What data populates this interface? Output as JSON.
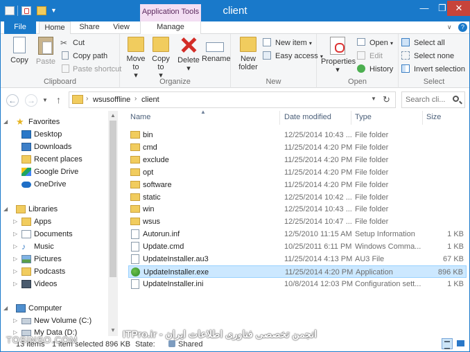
{
  "window": {
    "title": "client",
    "context_tab_label": "Application Tools",
    "min": "—",
    "max": "❐",
    "close": "✕"
  },
  "ribbon_tabs": [
    "File",
    "Home",
    "Share",
    "View",
    "Manage"
  ],
  "ribbon": {
    "clipboard": {
      "label": "Clipboard",
      "copy": "Copy",
      "paste": "Paste",
      "cut": "Cut",
      "copy_path": "Copy path",
      "paste_shortcut": "Paste shortcut"
    },
    "organize": {
      "label": "Organize",
      "move_to": "Move to",
      "copy_to": "Copy to",
      "delete": "Delete",
      "rename": "Rename"
    },
    "new": {
      "label": "New",
      "new_folder": "New folder",
      "new_item": "New item",
      "easy_access": "Easy access"
    },
    "open": {
      "label": "Open",
      "properties": "Properties",
      "open": "Open",
      "edit": "Edit",
      "history": "History"
    },
    "select": {
      "label": "Select",
      "select_all": "Select all",
      "select_none": "Select none",
      "invert_selection": "Invert selection"
    }
  },
  "address": {
    "crumbs": [
      "wsusoffline",
      "client"
    ],
    "search_placeholder": "Search cli..."
  },
  "nav_pane": {
    "items": [
      {
        "label": "Favorites",
        "icon": "star-icon"
      },
      {
        "label": "Desktop",
        "icon": "desktop-icon"
      },
      {
        "label": "Downloads",
        "icon": "downloads-icon"
      },
      {
        "label": "Recent places",
        "icon": "recent-places-icon"
      },
      {
        "label": "Google Drive",
        "icon": "google-drive-icon"
      },
      {
        "label": "OneDrive",
        "icon": "onedrive-icon"
      },
      {
        "label": "Libraries",
        "icon": "libraries-icon"
      },
      {
        "label": "Apps",
        "icon": "folder-icon"
      },
      {
        "label": "Documents",
        "icon": "documents-icon"
      },
      {
        "label": "Music",
        "icon": "music-icon"
      },
      {
        "label": "Pictures",
        "icon": "pictures-icon"
      },
      {
        "label": "Podcasts",
        "icon": "podcasts-icon"
      },
      {
        "label": "Videos",
        "icon": "videos-icon"
      },
      {
        "label": "Computer",
        "icon": "computer-icon"
      },
      {
        "label": "New Volume (C:)",
        "icon": "drive-icon"
      },
      {
        "label": "My Data (D:)",
        "icon": "drive-icon"
      }
    ]
  },
  "file_list": {
    "columns": [
      "Name",
      "Date modified",
      "Type",
      "Size"
    ],
    "rows": [
      {
        "name": "bin",
        "date": "12/25/2014 10:43 ...",
        "type": "File folder",
        "size": "",
        "kind": "folder"
      },
      {
        "name": "cmd",
        "date": "11/25/2014 4:20 PM",
        "type": "File folder",
        "size": "",
        "kind": "folder"
      },
      {
        "name": "exclude",
        "date": "11/25/2014 4:20 PM",
        "type": "File folder",
        "size": "",
        "kind": "folder"
      },
      {
        "name": "opt",
        "date": "11/25/2014 4:20 PM",
        "type": "File folder",
        "size": "",
        "kind": "folder"
      },
      {
        "name": "software",
        "date": "11/25/2014 4:20 PM",
        "type": "File folder",
        "size": "",
        "kind": "folder"
      },
      {
        "name": "static",
        "date": "12/25/2014 10:42 ...",
        "type": "File folder",
        "size": "",
        "kind": "folder"
      },
      {
        "name": "win",
        "date": "12/25/2014 10:43 ...",
        "type": "File folder",
        "size": "",
        "kind": "folder"
      },
      {
        "name": "wsus",
        "date": "12/25/2014 10:47 ...",
        "type": "File folder",
        "size": "",
        "kind": "folder"
      },
      {
        "name": "Autorun.inf",
        "date": "12/5/2010 11:15 AM",
        "type": "Setup Information",
        "size": "1 KB",
        "kind": "file"
      },
      {
        "name": "Update.cmd",
        "date": "10/25/2011 6:11 PM",
        "type": "Windows Comma...",
        "size": "1 KB",
        "kind": "file"
      },
      {
        "name": "UpdateInstaller.au3",
        "date": "11/25/2014 4:13 PM",
        "type": "AU3 File",
        "size": "67 KB",
        "kind": "file"
      },
      {
        "name": "UpdateInstaller.exe",
        "date": "11/25/2014 4:20 PM",
        "type": "Application",
        "size": "896 KB",
        "kind": "exe",
        "selected": true
      },
      {
        "name": "UpdateInstaller.ini",
        "date": "10/8/2014 12:03 PM",
        "type": "Configuration sett...",
        "size": "1 KB",
        "kind": "file"
      }
    ]
  },
  "status": {
    "item_count": "13 items",
    "selection": "1 item selected  896 KB",
    "state": "State:",
    "state_value": "Shared"
  },
  "watermarks": {
    "left": "TOSINSO.COM",
    "center": "ITPro.ir - انجمن تخصصی فناوری اطلاعات ایران"
  }
}
